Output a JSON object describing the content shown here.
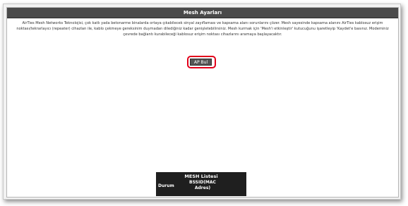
{
  "window": {
    "title": "Mesh Ayarları"
  },
  "description": "AirTies Mesh Networks Teknolojisi, çok katlı yada betonarme binalarda ortaya çıkabilecek sinyal zayıflaması ve kapsama alanı sorunlarını çözer. Mesh sayesinde kapsama alanını AirTies kablosuz erişim noktası/tekrarlayıcı (repeater) cihazları ile, kablo çekmeye gereksinim duymadan dilediğiniz kadar genişletebilirsiniz. Mesh kurmak için 'Mesh'i etkinleştir' kutucuğunu işaretleyip 'Kaydet'e basınız. Modeminiz çevrede bağlantı kurabileceği kablosuz erişim noktası cihazlarını aramaya başlayacaktır.",
  "actions": {
    "ap_search_label": "AP Bul"
  },
  "mesh_list": {
    "title": "MESH Listesi",
    "columns": [
      "Durum",
      "BSSID(MAC Adres)"
    ]
  },
  "colors": {
    "titlebar": "#4a4a4a",
    "highlight": "#e2001a",
    "button": "#555555",
    "table": "#1f1f1f"
  }
}
